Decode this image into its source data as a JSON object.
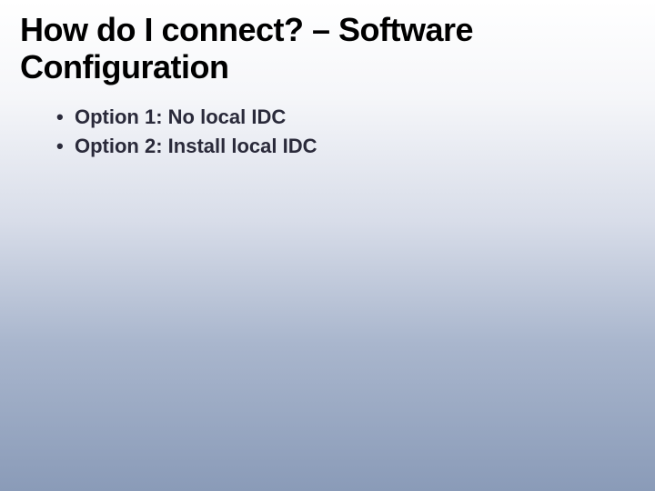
{
  "slide": {
    "title": "How do I connect? – Software Configuration",
    "bullets": [
      "Option 1: No local IDC",
      "Option 2: Install local IDC"
    ]
  }
}
